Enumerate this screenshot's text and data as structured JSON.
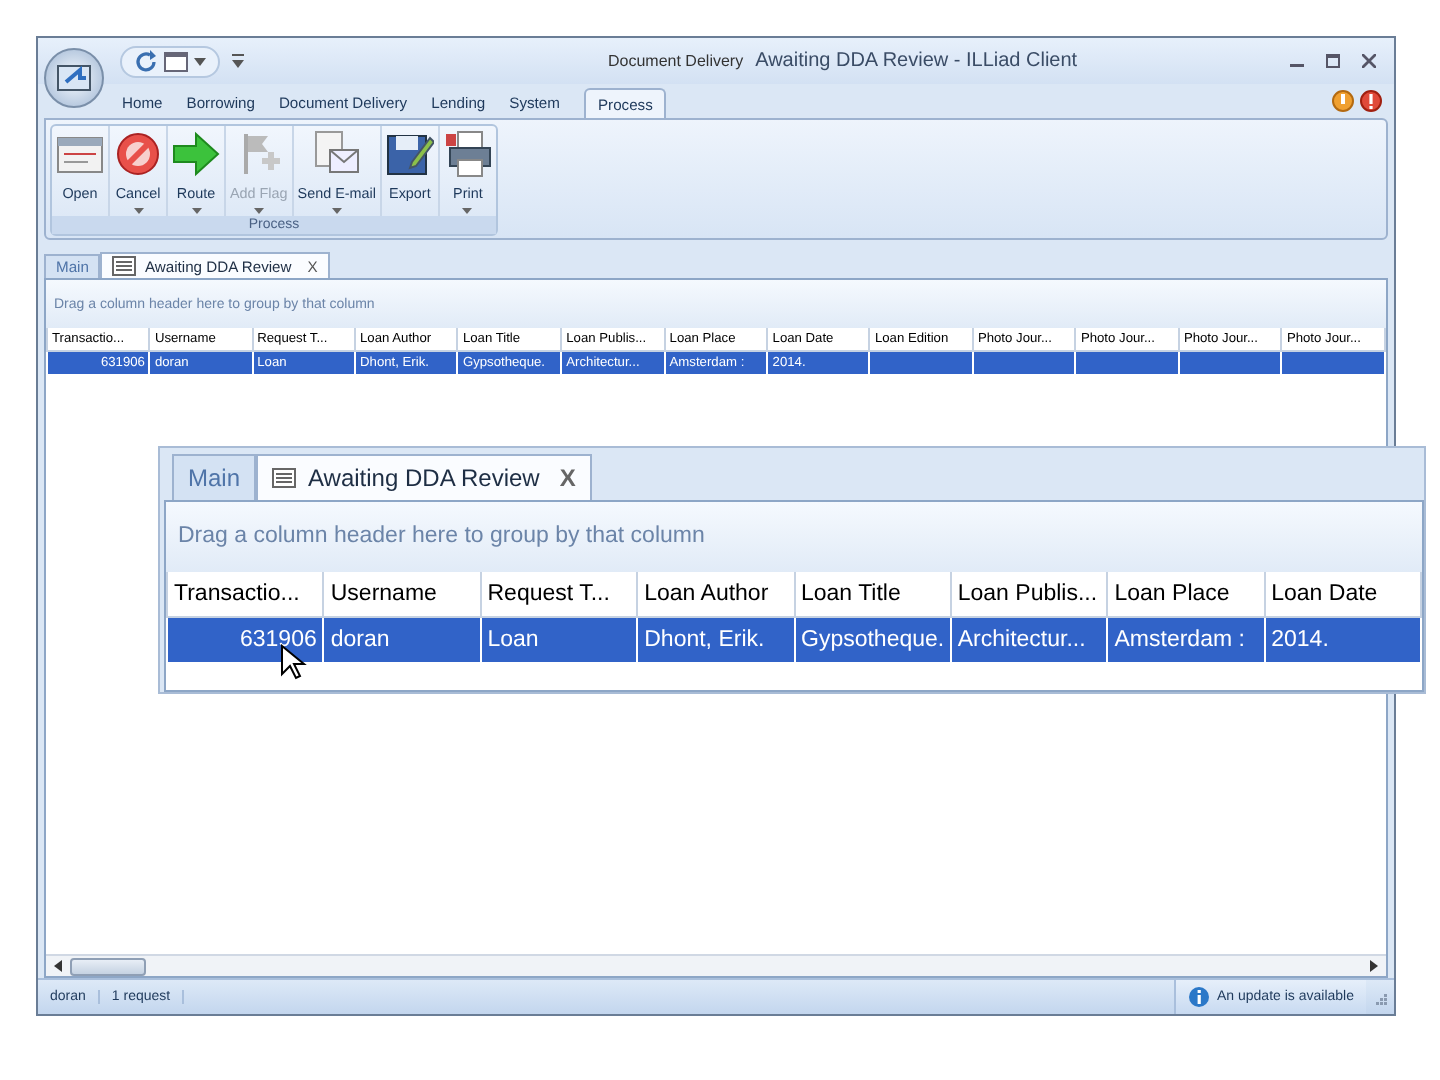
{
  "window": {
    "context_group": "Document Delivery",
    "title": "Awaiting DDA Review - ILLiad Client"
  },
  "ribbon_tabs": [
    {
      "label": "Home",
      "selected": false
    },
    {
      "label": "Borrowing",
      "selected": false
    },
    {
      "label": "Document Delivery",
      "selected": false
    },
    {
      "label": "Lending",
      "selected": false
    },
    {
      "label": "System",
      "selected": false
    },
    {
      "label": "Process",
      "selected": true
    }
  ],
  "ribbon_group": {
    "label": "Process",
    "buttons": [
      {
        "label": "Open",
        "dropdown": false,
        "disabled": false
      },
      {
        "label": "Cancel",
        "dropdown": true,
        "disabled": false
      },
      {
        "label": "Route",
        "dropdown": true,
        "disabled": false
      },
      {
        "label": "Add Flag",
        "dropdown": true,
        "disabled": true
      },
      {
        "label": "Send E-mail",
        "dropdown": true,
        "disabled": false
      },
      {
        "label": "Export",
        "dropdown": false,
        "disabled": false
      },
      {
        "label": "Print",
        "dropdown": true,
        "disabled": false
      }
    ]
  },
  "doc_tabs": [
    {
      "label": "Main",
      "selected": false
    },
    {
      "label": "Awaiting DDA Review",
      "selected": true,
      "close": "X"
    }
  ],
  "grid": {
    "group_hint": "Drag a column header here to group by that column",
    "columns": [
      "Transactio...",
      "Username",
      "Request T...",
      "Loan Author",
      "Loan Title",
      "Loan Publis...",
      "Loan Place",
      "Loan Date",
      "Loan Edition",
      "Photo Jour...",
      "Photo Jour...",
      "Photo Jour...",
      "Photo Jour..."
    ],
    "rows": [
      {
        "selected": true,
        "cells": [
          "631906",
          "doran",
          "Loan",
          "Dhont, Erik.",
          "Gypsotheque.",
          "Architectur...",
          "Amsterdam :",
          "2014."
        ]
      }
    ]
  },
  "zoom_callout": {
    "doc_tabs": [
      {
        "label": "Main",
        "selected": false
      },
      {
        "label": "Awaiting DDA Review",
        "selected": true,
        "close": "X"
      }
    ],
    "group_hint": "Drag a column header here to group by that column",
    "columns": [
      "Transactio...",
      "Username",
      "Request T...",
      "Loan Author",
      "Loan Title",
      "Loan Publis...",
      "Loan Place",
      "Loan Date"
    ],
    "rows": [
      {
        "selected": true,
        "cells": [
          "631906",
          "doran",
          "Loan",
          "Dhont, Erik.",
          "Gypsotheque.",
          "Architectur...",
          "Amsterdam :",
          "2014."
        ]
      }
    ]
  },
  "status_bar": {
    "user": "doran",
    "count": "1 request",
    "notice": "An update is available"
  }
}
